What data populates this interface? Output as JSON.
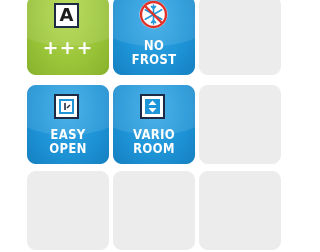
{
  "features": [
    {
      "energy_class": "A",
      "energy_suffix": "+++",
      "icon": "energy-label-icon"
    },
    {
      "label_line1": "NO",
      "label_line2": "FROST",
      "icon": "no-frost-snowflake-icon"
    },
    {
      "label_line1": "EASY",
      "label_line2": "OPEN",
      "icon": "easy-open-door-icon"
    },
    {
      "label_line1": "VARIO",
      "label_line2": "ROOM",
      "icon": "vario-room-arrows-icon"
    }
  ],
  "colors": {
    "energy_green": "#9cc63a",
    "feature_blue": "#1e95d8",
    "empty_tile": "#ececec",
    "icon_dark": "#1d2a44",
    "no_frost_red": "#e0322a"
  }
}
